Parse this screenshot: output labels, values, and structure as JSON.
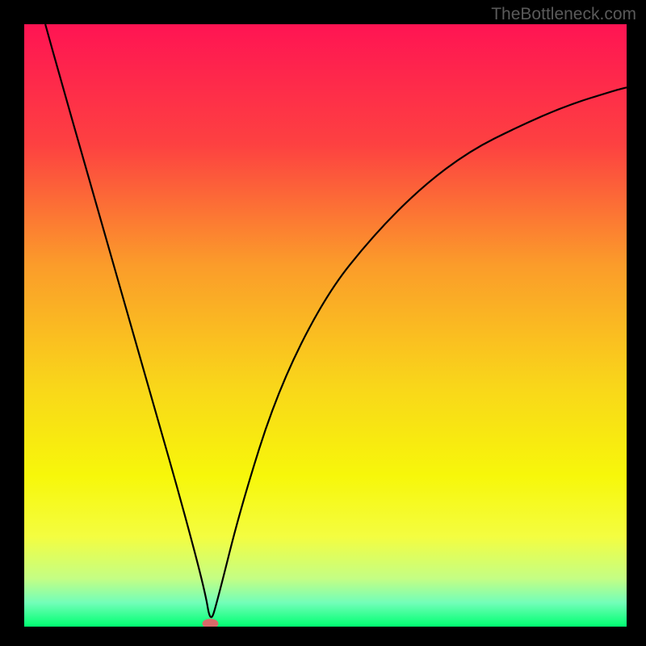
{
  "watermark": "TheBottleneck.com",
  "chart_data": {
    "type": "line",
    "title": "",
    "xlabel": "",
    "ylabel": "",
    "xlim": [
      0,
      100
    ],
    "ylim": [
      0,
      100
    ],
    "background": {
      "type": "vertical-gradient",
      "stops": [
        {
          "pos": 0.0,
          "color": "#ff1453"
        },
        {
          "pos": 0.2,
          "color": "#fd4141"
        },
        {
          "pos": 0.4,
          "color": "#fb9c2a"
        },
        {
          "pos": 0.6,
          "color": "#f9d61a"
        },
        {
          "pos": 0.75,
          "color": "#f7f70a"
        },
        {
          "pos": 0.85,
          "color": "#f4fd40"
        },
        {
          "pos": 0.92,
          "color": "#c4fe84"
        },
        {
          "pos": 0.96,
          "color": "#73feb9"
        },
        {
          "pos": 1.0,
          "color": "#00ff71"
        }
      ]
    },
    "series": [
      {
        "name": "bottleneck-curve",
        "x": [
          3.5,
          6,
          10,
          14,
          18,
          22,
          26,
          30,
          30.9,
          32,
          36,
          42,
          50,
          58,
          66,
          74,
          82,
          90,
          98,
          100
        ],
        "y": [
          100,
          91,
          77,
          63,
          49,
          35,
          21,
          6,
          0.5,
          4,
          20,
          39,
          55,
          65,
          73,
          79,
          83,
          86.5,
          89,
          89.5
        ]
      }
    ],
    "marker": {
      "x": 30.9,
      "y": 0.5,
      "color": "#d96a6a",
      "rx": 10,
      "ry": 6
    },
    "frame": {
      "stroke": "#000000",
      "width_top_left": 30,
      "width_bottom_right": 24
    }
  }
}
